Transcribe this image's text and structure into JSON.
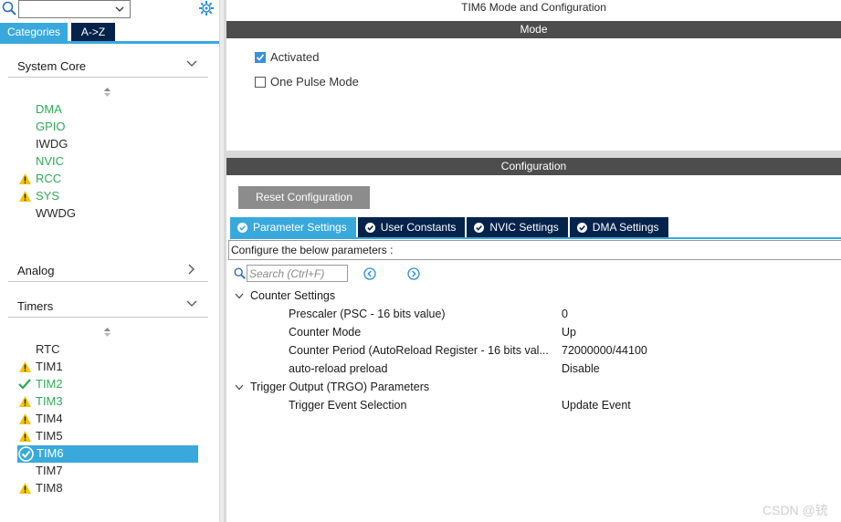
{
  "sidebar": {
    "search_value": "",
    "tabs": [
      {
        "label": "Categories",
        "active": true
      },
      {
        "label": "A->Z",
        "active": false
      }
    ],
    "groups": {
      "system_core": {
        "label": "System Core",
        "items": [
          {
            "label": "DMA",
            "status": "ok-green"
          },
          {
            "label": "GPIO",
            "status": "ok-green"
          },
          {
            "label": "IWDG",
            "status": "none"
          },
          {
            "label": "NVIC",
            "status": "ok-green"
          },
          {
            "label": "RCC",
            "status": "warning"
          },
          {
            "label": "SYS",
            "status": "warning"
          },
          {
            "label": "WWDG",
            "status": "none"
          }
        ]
      },
      "analog": {
        "label": "Analog"
      },
      "timers": {
        "label": "Timers",
        "items": [
          {
            "label": "RTC",
            "status": "none"
          },
          {
            "label": "TIM1",
            "status": "warning"
          },
          {
            "label": "TIM2",
            "status": "check"
          },
          {
            "label": "TIM3",
            "status": "warning"
          },
          {
            "label": "TIM4",
            "status": "warning"
          },
          {
            "label": "TIM5",
            "status": "warning"
          },
          {
            "label": "TIM6",
            "status": "selected"
          },
          {
            "label": "TIM7",
            "status": "none"
          },
          {
            "label": "TIM8",
            "status": "warning"
          }
        ]
      }
    }
  },
  "main": {
    "title": "TIM6 Mode and Configuration",
    "mode_header": "Mode",
    "mode": {
      "activated_label": "Activated",
      "activated_checked": true,
      "one_pulse_label": "One Pulse Mode",
      "one_pulse_checked": false
    },
    "config_header": "Configuration",
    "reset_button": "Reset Configuration",
    "tabs": [
      {
        "label": "Parameter Settings",
        "active": true
      },
      {
        "label": "User Constants",
        "active": false
      },
      {
        "label": "NVIC Settings",
        "active": false
      },
      {
        "label": "DMA Settings",
        "active": false
      }
    ],
    "configure_text": "Configure the below parameters :",
    "search_placeholder": "Search (Ctrl+F)",
    "counter_settings": {
      "label": "Counter Settings",
      "params": [
        {
          "name": "Prescaler (PSC - 16 bits value)",
          "value": "0"
        },
        {
          "name": "Counter Mode",
          "value": "Up"
        },
        {
          "name": "Counter Period (AutoReload Register - 16 bits val...",
          "value": "72000000/44100"
        },
        {
          "name": "auto-reload preload",
          "value": "Disable"
        }
      ]
    },
    "trigger_output": {
      "label": "Trigger Output (TRGO) Parameters",
      "params": [
        {
          "name": "Trigger Event Selection",
          "value": "Update Event"
        }
      ]
    }
  },
  "watermark": "CSDN @铳",
  "colors": {
    "accent": "#39a9dc",
    "navy": "#03234b",
    "bar": "#4d4d4d",
    "ok_green": "#2eaa57",
    "warning": "#f5c400"
  }
}
